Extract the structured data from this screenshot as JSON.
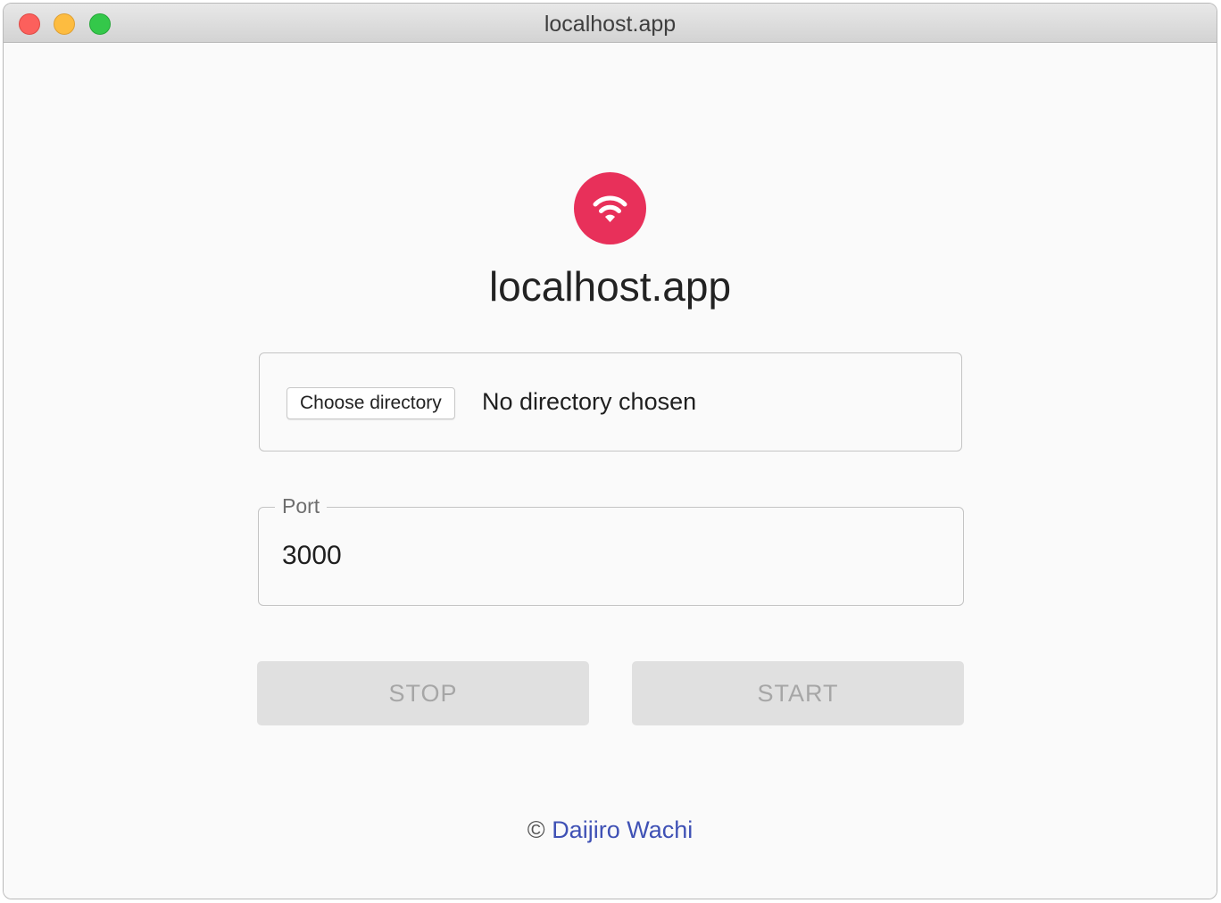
{
  "window": {
    "title": "localhost.app",
    "controls": [
      "close",
      "minimize",
      "zoom"
    ]
  },
  "app": {
    "logo_icon": "wifi-icon",
    "logo_color": "#e8305a",
    "title": "localhost.app"
  },
  "directory": {
    "button_label": "Choose directory",
    "status": "No directory chosen"
  },
  "port": {
    "label": "Port",
    "value": "3000"
  },
  "actions": {
    "stop_label": "STOP",
    "start_label": "START",
    "stop_disabled": true,
    "start_disabled": true
  },
  "footer": {
    "copyright_symbol": "©",
    "author": "Daijiro Wachi",
    "link_color": "#3f51b5"
  }
}
